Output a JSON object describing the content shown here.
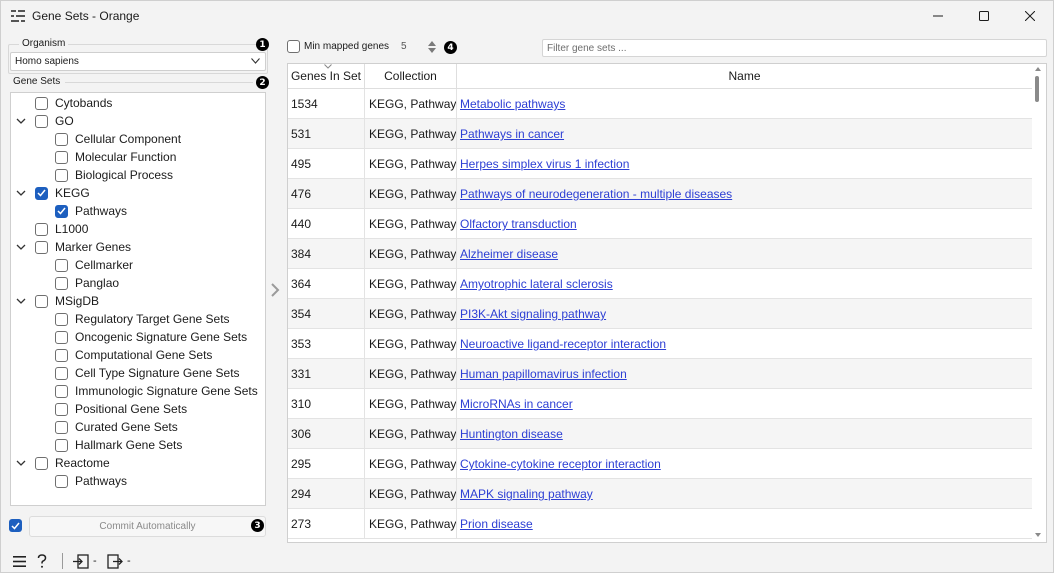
{
  "window": {
    "title": "Gene Sets - Orange"
  },
  "icons": {
    "app": "orange-widget-icon",
    "minimize": "minimize-icon",
    "maximize": "maximize-icon",
    "close": "close-icon",
    "menu": "hamburger-menu-icon",
    "help": "question-mark-icon",
    "input": "input-signal-icon",
    "output": "output-signal-icon"
  },
  "organism": {
    "label": "Organism",
    "selected": "Homo sapiens",
    "badge": "1"
  },
  "gene_sets": {
    "label": "Gene Sets",
    "badge": "2",
    "items": [
      {
        "label": "Cytobands",
        "level": 0,
        "checked": false,
        "expandable": false
      },
      {
        "label": "GO",
        "level": 0,
        "checked": false,
        "expandable": true
      },
      {
        "label": "Cellular Component",
        "level": 1,
        "checked": false,
        "expandable": false
      },
      {
        "label": "Molecular Function",
        "level": 1,
        "checked": false,
        "expandable": false
      },
      {
        "label": "Biological Process",
        "level": 1,
        "checked": false,
        "expandable": false
      },
      {
        "label": "KEGG",
        "level": 0,
        "checked": true,
        "expandable": true
      },
      {
        "label": "Pathways",
        "level": 1,
        "checked": true,
        "expandable": false
      },
      {
        "label": "L1000",
        "level": 0,
        "checked": false,
        "expandable": false
      },
      {
        "label": "Marker Genes",
        "level": 0,
        "checked": false,
        "expandable": true
      },
      {
        "label": "Cellmarker",
        "level": 1,
        "checked": false,
        "expandable": false
      },
      {
        "label": "Panglao",
        "level": 1,
        "checked": false,
        "expandable": false
      },
      {
        "label": "MSigDB",
        "level": 0,
        "checked": false,
        "expandable": true
      },
      {
        "label": "Regulatory Target Gene Sets",
        "level": 1,
        "checked": false,
        "expandable": false
      },
      {
        "label": "Oncogenic Signature Gene Sets",
        "level": 1,
        "checked": false,
        "expandable": false
      },
      {
        "label": "Computational Gene Sets",
        "level": 1,
        "checked": false,
        "expandable": false
      },
      {
        "label": "Cell Type Signature Gene Sets",
        "level": 1,
        "checked": false,
        "expandable": false
      },
      {
        "label": "Immunologic Signature Gene Sets",
        "level": 1,
        "checked": false,
        "expandable": false
      },
      {
        "label": "Positional Gene Sets",
        "level": 1,
        "checked": false,
        "expandable": false
      },
      {
        "label": "Curated Gene Sets",
        "level": 1,
        "checked": false,
        "expandable": false
      },
      {
        "label": "Hallmark Gene Sets",
        "level": 1,
        "checked": false,
        "expandable": false
      },
      {
        "label": "Reactome",
        "level": 0,
        "checked": false,
        "expandable": true
      },
      {
        "label": "Pathways",
        "level": 1,
        "checked": false,
        "expandable": false
      }
    ]
  },
  "commit": {
    "label": "Commit Automatically",
    "checked": true,
    "badge": "3"
  },
  "filters": {
    "min_mapped_label": "Min mapped genes",
    "min_mapped_checked": false,
    "min_mapped_value": "5",
    "badge": "4",
    "search_placeholder": "Filter gene sets ..."
  },
  "table": {
    "columns": [
      "Genes In Set",
      "Collection",
      "Name"
    ],
    "rows": [
      {
        "genes": "1534",
        "collection": "KEGG, Pathways",
        "name": "Metabolic pathways"
      },
      {
        "genes": "531",
        "collection": "KEGG, Pathways",
        "name": "Pathways in cancer"
      },
      {
        "genes": "495",
        "collection": "KEGG, Pathways",
        "name": "Herpes simplex virus 1 infection"
      },
      {
        "genes": "476",
        "collection": "KEGG, Pathways",
        "name": "Pathways of neurodegeneration - multiple diseases"
      },
      {
        "genes": "440",
        "collection": "KEGG, Pathways",
        "name": "Olfactory transduction"
      },
      {
        "genes": "384",
        "collection": "KEGG, Pathways",
        "name": "Alzheimer disease"
      },
      {
        "genes": "364",
        "collection": "KEGG, Pathways",
        "name": "Amyotrophic lateral sclerosis"
      },
      {
        "genes": "354",
        "collection": "KEGG, Pathways",
        "name": "PI3K-Akt signaling pathway"
      },
      {
        "genes": "353",
        "collection": "KEGG, Pathways",
        "name": "Neuroactive ligand-receptor interaction"
      },
      {
        "genes": "331",
        "collection": "KEGG, Pathways",
        "name": "Human papillomavirus infection"
      },
      {
        "genes": "310",
        "collection": "KEGG, Pathways",
        "name": "MicroRNAs in cancer"
      },
      {
        "genes": "306",
        "collection": "KEGG, Pathways",
        "name": "Huntington disease"
      },
      {
        "genes": "295",
        "collection": "KEGG, Pathways",
        "name": "Cytokine-cytokine receptor interaction"
      },
      {
        "genes": "294",
        "collection": "KEGG, Pathways",
        "name": "MAPK signaling pathway"
      },
      {
        "genes": "273",
        "collection": "KEGG, Pathways",
        "name": "Prion disease"
      }
    ]
  },
  "bottom_bar": {
    "input_status": "-",
    "output_status": "-"
  },
  "colors": {
    "accent": "#1d5fbf",
    "link": "#2d3fd4",
    "row_alt": "#f5f5f5"
  }
}
